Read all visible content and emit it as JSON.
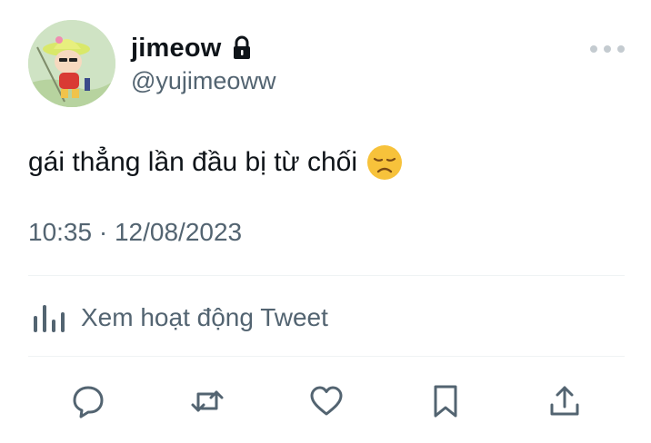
{
  "tweet": {
    "display_name": "jimeow",
    "handle": "@yujimeoww",
    "text": "gái thẳng lần đầu bị từ chối",
    "emoji": "disappointed-face-emoji",
    "time": "10:35",
    "separator": "·",
    "date": "12/08/2023"
  },
  "analytics": {
    "label": "Xem hoạt động Tweet"
  },
  "icons": {
    "lock": "lock-icon",
    "more": "more-horizontal-icon",
    "analytics": "bar-chart-icon",
    "reply": "reply-icon",
    "retweet": "retweet-icon",
    "like": "heart-icon",
    "bookmark": "bookmark-icon",
    "share": "share-icon"
  },
  "colors": {
    "text": "#0f1419",
    "secondary": "#536471",
    "divider": "#eff3f4",
    "emoji": "#f7c23b"
  }
}
